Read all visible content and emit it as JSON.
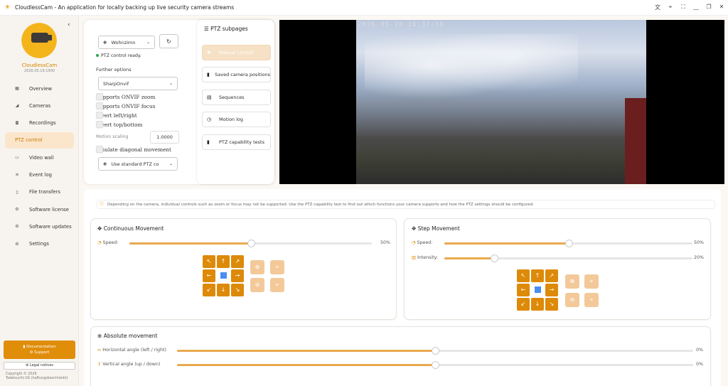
{
  "window": {
    "title": "CloudlessCam - An application for locally backing up live security camera streams",
    "buttons": [
      "translate-icon",
      "pin-icon",
      "fullscreen-icon",
      "minimize-icon",
      "restore-icon",
      "close-icon"
    ]
  },
  "sidebar": {
    "brand": "CloudlessCam",
    "version": "2026.05.19.1900",
    "items": [
      {
        "label": "Overview",
        "icon": "grid-icon"
      },
      {
        "label": "Cameras",
        "icon": "camera-icon"
      },
      {
        "label": "Recordings",
        "icon": "record-icon"
      },
      {
        "label": "PTZ control",
        "icon": "ptz-icon",
        "active": true
      },
      {
        "label": "Video wall",
        "icon": "monitor-icon"
      },
      {
        "label": "Event log",
        "icon": "list-icon"
      },
      {
        "label": "File transfers",
        "icon": "file-icon"
      },
      {
        "label": "Software license",
        "icon": "license-icon"
      },
      {
        "label": "Software updates",
        "icon": "update-icon"
      },
      {
        "label": "Settings",
        "icon": "gear-icon"
      }
    ],
    "documentation": "Documentation",
    "support": "Support",
    "legal": "Legal notices",
    "copyright": "Copyright © 2026",
    "company": "Tadelsucht UG (haftungsbeschränkt)"
  },
  "ptz": {
    "camera": "Wohnzimn",
    "status": "PTZ control ready.",
    "further_options": "Further options",
    "driver": "SharpOnvif",
    "checks": [
      "Supports ONVIF zoom",
      "Supports ONVIF focus",
      "Invert left/right",
      "Invert top/bottom"
    ],
    "motion_scaling_label": "Motion scaling",
    "motion_scaling_value": "1.0000",
    "diagonal": "Emulate diagonal movement",
    "ptz_command": "Use standard PTZ co"
  },
  "subpages": {
    "title": "PTZ subpages",
    "items": [
      {
        "label": "Manual control",
        "disabled": true
      },
      {
        "label": "Saved camera positions"
      },
      {
        "label": "Sequences"
      },
      {
        "label": "Motion log"
      },
      {
        "label": "PTZ capability tests"
      }
    ]
  },
  "video": {
    "timestamp": "2026-05-20 16:37:58"
  },
  "info": "Depending on the camera, individual controls such as zoom or focus may not be supported. Use the PTZ capability test to find out which functions your camera supports and how the PTZ settings should be configured.",
  "continuous": {
    "title": "Continuous Movement",
    "speed_label": "Speed:",
    "speed_value": "50%",
    "speed": 0.5
  },
  "step": {
    "title": "Step Movement",
    "speed_label": "Speed:",
    "speed_value": "50%",
    "speed": 0.5,
    "intensity_label": "Intensity:",
    "intensity_value": "20%",
    "intensity": 0.2
  },
  "absolute": {
    "title": "Absolute movement",
    "h_label": "Horizontal angle (left / right)",
    "h_value": "0%",
    "h": 0.5,
    "v_label": "Vertical angle (up / down)",
    "v_value": "0%",
    "v": 0.5
  }
}
